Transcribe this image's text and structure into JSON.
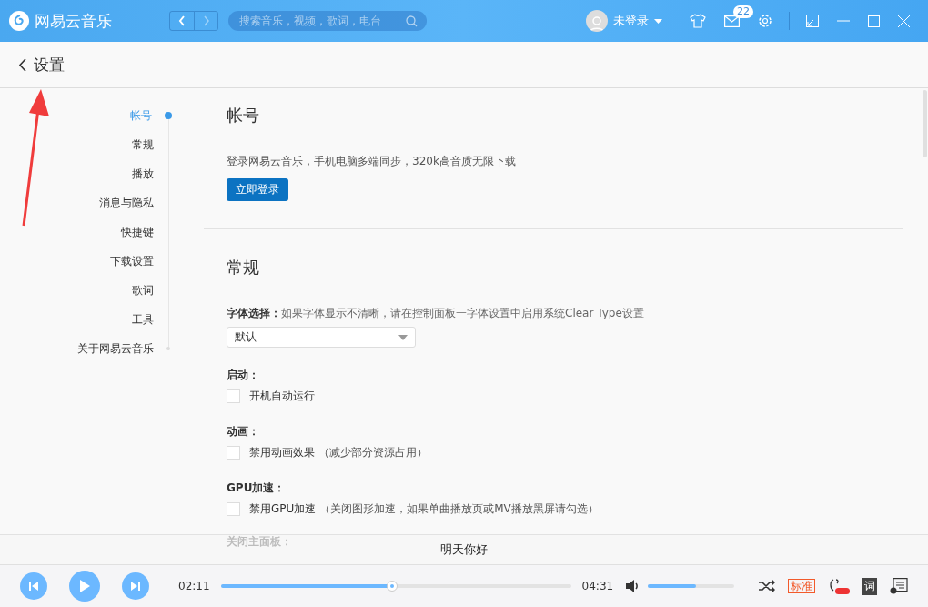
{
  "header": {
    "app_name": "网易云音乐",
    "back_enabled": true,
    "forward_enabled": false,
    "search": {
      "placeholder": "搜索音乐，视频，歌词，电台"
    },
    "user": "未登录",
    "message_count": "22"
  },
  "page_title": "设置",
  "nav": [
    {
      "label": "帐号",
      "selected": true
    },
    {
      "label": "常规",
      "selected": false
    },
    {
      "label": "播放",
      "selected": false
    },
    {
      "label": "消息与隐私",
      "selected": false
    },
    {
      "label": "快捷键",
      "selected": false
    },
    {
      "label": "下载设置",
      "selected": false
    },
    {
      "label": "歌词",
      "selected": false
    },
    {
      "label": "工具",
      "selected": false
    },
    {
      "label": "关于网易云音乐",
      "selected": false
    }
  ],
  "account": {
    "title": "帐号",
    "description": "登录网易云音乐，手机电脑多端同步，320k高音质无限下载",
    "button": "立即登录"
  },
  "general": {
    "title": "常规",
    "groups": [
      {
        "kind": "select",
        "label": "字体选择：",
        "hint": "如果字体显示不清晰，请在控制面板一字体设置中启用系统Clear Type设置",
        "value": "默认"
      },
      {
        "kind": "checkbox",
        "label": "启动：",
        "option": "开机自动运行",
        "checked": false
      },
      {
        "kind": "checkbox",
        "label": "动画：",
        "option": "禁用动画效果",
        "note": "（减少部分资源占用）",
        "checked": false
      },
      {
        "kind": "checkbox",
        "label": "GPU加速：",
        "option": "禁用GPU加速",
        "note": "（关闭图形加速，如果单曲播放页或MV播放黑屏请勾选）",
        "checked": false
      },
      {
        "kind": "heading",
        "label": "关闭主面板："
      }
    ]
  },
  "lyric": "明天你好",
  "player": {
    "elapsed": "02:11",
    "total": "04:31",
    "progress": {
      "level": 0.49
    },
    "volume": {
      "level": 0.56
    },
    "quality": "标准",
    "lyric_button": "词"
  }
}
